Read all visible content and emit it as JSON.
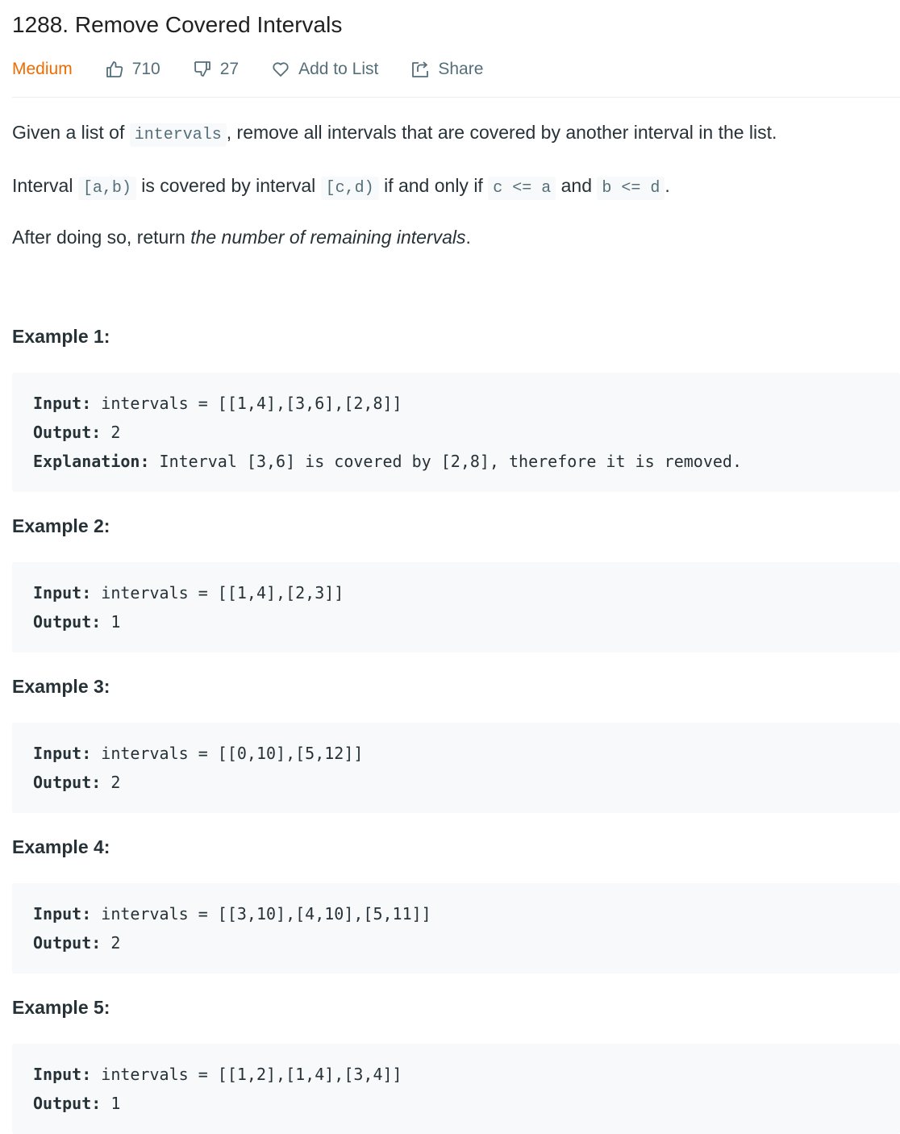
{
  "problem": {
    "title": "1288. Remove Covered Intervals",
    "difficulty": "Medium",
    "difficulty_color": "#ef6c00",
    "likes": "710",
    "dislikes": "27",
    "add_to_list_label": "Add to List",
    "share_label": "Share"
  },
  "description": {
    "p1": {
      "before": "Given a list of ",
      "code": "intervals",
      "after": ", remove all intervals that are covered by another interval in the list."
    },
    "p2": {
      "t1": "Interval ",
      "c1": "[a,b)",
      "t2": " is covered by interval ",
      "c2": "[c,d)",
      "t3": " if and only if ",
      "c3": "c <= a",
      "t4": " and ",
      "c4": "b <= d",
      "t5": "."
    },
    "p3": {
      "before": "After doing so, return ",
      "em": "the number of remaining intervals",
      "after": "."
    }
  },
  "examples": [
    {
      "title": "Example 1:",
      "input_label": "Input:",
      "input": " intervals = [[1,4],[3,6],[2,8]]",
      "output_label": "Output:",
      "output": " 2",
      "explanation_label": "Explanation:",
      "explanation": " Interval [3,6] is covered by [2,8], therefore it is removed."
    },
    {
      "title": "Example 2:",
      "input_label": "Input:",
      "input": " intervals = [[1,4],[2,3]]",
      "output_label": "Output:",
      "output": " 1"
    },
    {
      "title": "Example 3:",
      "input_label": "Input:",
      "input": " intervals = [[0,10],[5,12]]",
      "output_label": "Output:",
      "output": " 2"
    },
    {
      "title": "Example 4:",
      "input_label": "Input:",
      "input": " intervals = [[3,10],[4,10],[5,11]]",
      "output_label": "Output:",
      "output": " 2"
    },
    {
      "title": "Example 5:",
      "input_label": "Input:",
      "input": " intervals = [[1,2],[1,4],[3,4]]",
      "output_label": "Output:",
      "output": " 1"
    }
  ]
}
